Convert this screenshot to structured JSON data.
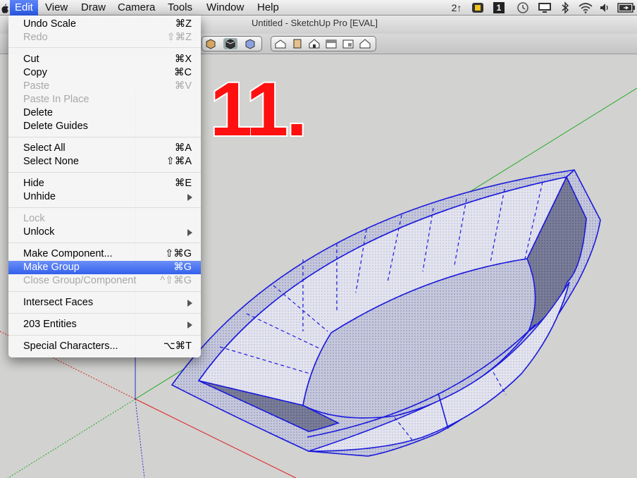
{
  "menubar": {
    "items": [
      "Edit",
      "View",
      "Draw",
      "Camera",
      "Tools",
      "Window",
      "Help"
    ],
    "active": "Edit",
    "tray": {
      "spaces": "2↑",
      "desktop": "1"
    }
  },
  "window": {
    "title": "Untitled - SketchUp Pro [EVAL]"
  },
  "overlay": {
    "step_text": "11."
  },
  "edit_menu": {
    "undo": {
      "label": "Undo Scale",
      "shortcut": "⌘Z"
    },
    "redo": {
      "label": "Redo",
      "shortcut": "⇧⌘Z"
    },
    "cut": {
      "label": "Cut",
      "shortcut": "⌘X"
    },
    "copy": {
      "label": "Copy",
      "shortcut": "⌘C"
    },
    "paste": {
      "label": "Paste",
      "shortcut": "⌘V"
    },
    "paste_in_place": {
      "label": "Paste In Place"
    },
    "delete": {
      "label": "Delete"
    },
    "delete_guides": {
      "label": "Delete Guides"
    },
    "select_all": {
      "label": "Select All",
      "shortcut": "⌘A"
    },
    "select_none": {
      "label": "Select None",
      "shortcut": "⇧⌘A"
    },
    "hide": {
      "label": "Hide",
      "shortcut": "⌘E"
    },
    "unhide": {
      "label": "Unhide"
    },
    "lock": {
      "label": "Lock"
    },
    "unlock": {
      "label": "Unlock"
    },
    "make_component": {
      "label": "Make Component...",
      "shortcut": "⇧⌘G"
    },
    "make_group": {
      "label": "Make Group",
      "shortcut": "⌘G"
    },
    "close_group": {
      "label": "Close Group/Component",
      "shortcut": "^⇧⌘G"
    },
    "intersect_faces": {
      "label": "Intersect Faces"
    },
    "entities": {
      "label": "203 Entities"
    },
    "special_characters": {
      "label": "Special Characters...",
      "shortcut": "⌥⌘T"
    }
  },
  "colors": {
    "accent": "#3461ec",
    "model_edge": "#1a1adc",
    "axis_red": "#e02020",
    "axis_green": "#22aa22",
    "axis_blue": "#2a2ad0",
    "step_text": "#ff1010"
  }
}
